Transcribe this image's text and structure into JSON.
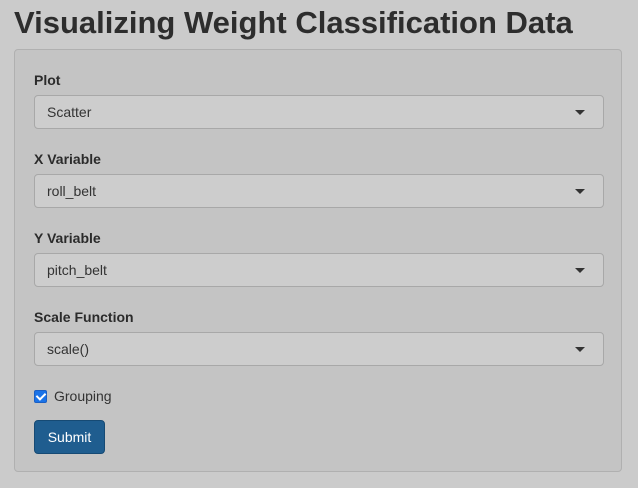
{
  "page": {
    "title": "Visualizing Weight Classification Data"
  },
  "form": {
    "plot": {
      "label": "Plot",
      "value": "Scatter"
    },
    "x_variable": {
      "label": "X Variable",
      "value": "roll_belt"
    },
    "y_variable": {
      "label": "Y Variable",
      "value": "pitch_belt"
    },
    "scale_function": {
      "label": "Scale Function",
      "value": "scale()"
    },
    "grouping": {
      "label": "Grouping",
      "checked": true
    },
    "submit_label": "Submit"
  },
  "colors": {
    "background": "#cbcbcb",
    "panel": "#c4c4c4",
    "submit_button": "#1f5d8f",
    "checkbox_accent": "#1a73e8"
  },
  "icons": {
    "dropdown": "caret-down-icon",
    "checkbox": "checkmark-icon"
  }
}
